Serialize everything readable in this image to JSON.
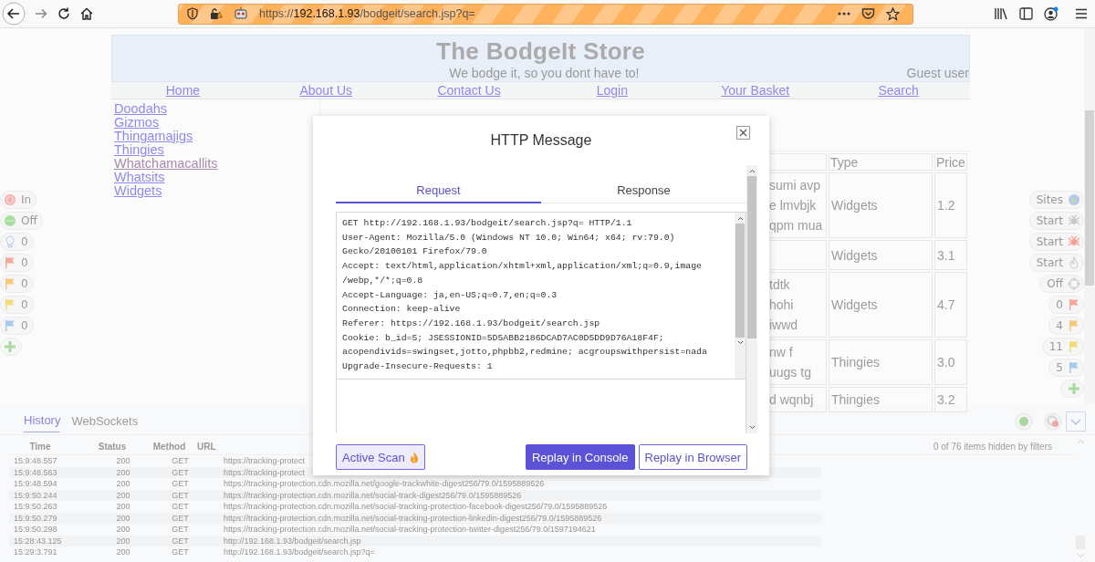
{
  "browser": {
    "url_scheme": "https://",
    "url_host": "192.168.1.93",
    "url_path": "/bodgeit/search.jsp?q="
  },
  "store": {
    "title": "The BodgeIt Store",
    "tagline": "We bodge it, so you dont have to!",
    "user": "Guest user",
    "nav": [
      "Home",
      "About Us",
      "Contact Us",
      "Login",
      "Your Basket",
      "Search"
    ],
    "categories": [
      {
        "label": "Doodahs",
        "visited": false
      },
      {
        "label": "Gizmos",
        "visited": false
      },
      {
        "label": "Thingamajigs",
        "visited": false
      },
      {
        "label": "Thingies",
        "visited": false
      },
      {
        "label": "Whatchamacallits",
        "visited": true
      },
      {
        "label": "Whatsits",
        "visited": false
      },
      {
        "label": "Widgets",
        "visited": false
      }
    ],
    "table": {
      "columns": [
        "Type",
        "Price"
      ],
      "rows": [
        {
          "column_1": [
            "sumi avp",
            "e lmvbjk",
            "qpm mua"
          ],
          "type": "Widgets",
          "price": "1.2"
        },
        {
          "column_1": [],
          "type": "Widgets",
          "price": "3.1"
        },
        {
          "column_1": [
            "tdtk",
            "hohi",
            "iwwd"
          ],
          "type": "Widgets",
          "price": "4.7"
        },
        {
          "column_1": [
            "nw f",
            "uugs tg"
          ],
          "type": "Thingies",
          "price": "3.0"
        },
        {
          "column_1": [
            "d wqnbj"
          ],
          "type": "Thingies",
          "price": "3.2"
        }
      ]
    }
  },
  "hud_left": [
    {
      "kind": "target",
      "label": "In"
    },
    {
      "kind": "dot",
      "label": "Off"
    },
    {
      "kind": "bulb",
      "label": "0"
    },
    {
      "kind": "flag",
      "color": "#f4a89a",
      "label": "0"
    },
    {
      "kind": "flag",
      "color": "#f8c77e",
      "label": "0"
    },
    {
      "kind": "flag",
      "color": "#f3dc78",
      "label": "0"
    },
    {
      "kind": "flag",
      "color": "#a9c8ee",
      "label": "0"
    },
    {
      "kind": "plus"
    }
  ],
  "hud_right": [
    {
      "kind": "globe",
      "label": "Sites"
    },
    {
      "kind": "spider",
      "color": "#c8c8c8",
      "label": "Start"
    },
    {
      "kind": "spider",
      "color": "#f2a090",
      "label": "Start"
    },
    {
      "kind": "flame",
      "label": "Start"
    },
    {
      "kind": "crosshair",
      "label": "Off"
    },
    {
      "kind": "flag",
      "color": "#f4a89a",
      "label": "0"
    },
    {
      "kind": "flag",
      "color": "#f8c77e",
      "label": "4"
    },
    {
      "kind": "flag",
      "color": "#f3dc78",
      "label": "11"
    },
    {
      "kind": "flag",
      "color": "#a9c8ee",
      "label": "5"
    },
    {
      "kind": "plus"
    }
  ],
  "modal": {
    "title": "HTTP Message",
    "tabs": [
      {
        "label": "Request",
        "selected": true
      },
      {
        "label": "Response",
        "selected": false
      }
    ],
    "request_lines": [
      "GET http://192.168.1.93/bodgeit/search.jsp?q= HTTP/1.1",
      "User-Agent: Mozilla/5.0 (Windows NT 10.0; Win64; x64; rv:79.0)",
      "Gecko/20100101 Firefox/79.0",
      "Accept: text/html,application/xhtml+xml,application/xml;q=0.9,image",
      "/webp,*/*;q=0.8",
      "Accept-Language: ja,en-US;q=0.7,en;q=0.3",
      "Connection: keep-alive",
      "Referer: https://192.168.1.93/bodgeit/search.jsp",
      "Cookie: b_id=5; JSESSIONID=5D5ABB2186DCAD7AC0D5DD9D76A18F4F;",
      "acopendivids=swingset,jotto,phpbb2,redmine; acgroupswithpersist=nada",
      "Upgrade-Insecure-Requests: 1"
    ],
    "buttons": [
      {
        "kind": "scan",
        "label": "Active Scan"
      },
      {
        "kind": "primary",
        "label": "Replay in Console"
      },
      {
        "kind": "outline",
        "label": "Replay in Browser"
      }
    ]
  },
  "drawer": {
    "tabs": [
      {
        "label": "History",
        "selected": true
      },
      {
        "label": "WebSockets",
        "selected": false
      }
    ],
    "columns": [
      "Time",
      "Status",
      "Method",
      "URL"
    ],
    "filter_note": "0 of 76 items hidden by filters",
    "rows": [
      {
        "time": "15:9:48.557",
        "status": "200",
        "method": "GET",
        "url": "https://tracking-protect"
      },
      {
        "time": "15:9:48.563",
        "status": "200",
        "method": "GET",
        "url": "https://tracking-protect"
      },
      {
        "time": "15:9:48.594",
        "status": "200",
        "method": "GET",
        "url": "https://tracking-protection.cdn.mozilla.net/google-trackwhite-digest256/79.0/1595889526"
      },
      {
        "time": "15:9:50.244",
        "status": "200",
        "method": "GET",
        "url": "https://tracking-protection.cdn.mozilla.net/social-track-digest256/79.0/1595889526"
      },
      {
        "time": "15:9:50.263",
        "status": "200",
        "method": "GET",
        "url": "https://tracking-protection.cdn.mozilla.net/social-tracking-protection-facebook-digest256/79.0/1595889526"
      },
      {
        "time": "15:9:50.279",
        "status": "200",
        "method": "GET",
        "url": "https://tracking-protection.cdn.mozilla.net/social-tracking-protection-linkedin-digest256/79.0/1595889526"
      },
      {
        "time": "15:9:50.298",
        "status": "200",
        "method": "GET",
        "url": "https://tracking-protection.cdn.mozilla.net/social-tracking-protection-twitter-digest256/79.0/1597194621"
      },
      {
        "time": "15:28:43.125",
        "status": "200",
        "method": "GET",
        "url": "http://192.168.1.93/bodgeit/search.jsp"
      },
      {
        "time": "15:29:3.791",
        "status": "200",
        "method": "GET",
        "url": "http://192.168.1.93/bodgeit/search.jsp?q="
      }
    ]
  }
}
